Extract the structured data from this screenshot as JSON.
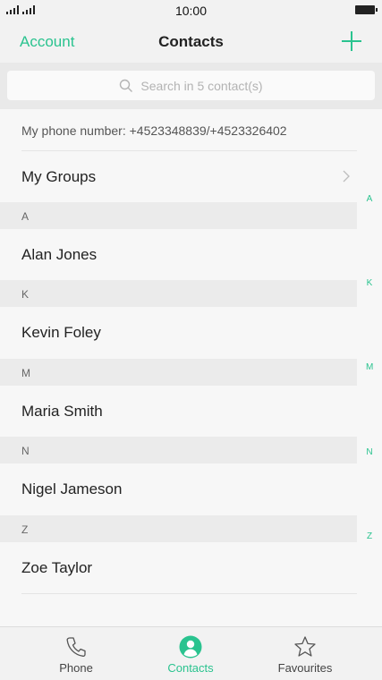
{
  "status_bar": {
    "time": "10:00"
  },
  "nav": {
    "account": "Account",
    "title": "Contacts"
  },
  "search": {
    "placeholder": "Search in 5 contact(s)"
  },
  "my_number": "My phone number: +4523348839/+4523326402",
  "groups_label": "My Groups",
  "sections": [
    {
      "letter": "A",
      "contact": "Alan Jones"
    },
    {
      "letter": "K",
      "contact": "Kevin Foley"
    },
    {
      "letter": "M",
      "contact": "Maria Smith"
    },
    {
      "letter": "N",
      "contact": "Nigel Jameson"
    },
    {
      "letter": "Z",
      "contact": "Zoe Taylor"
    }
  ],
  "index_letters": [
    "A",
    "K",
    "M",
    "N",
    "Z"
  ],
  "tabs": [
    {
      "label": "Phone",
      "icon": "phone-icon"
    },
    {
      "label": "Contacts",
      "icon": "person-icon",
      "active": true
    },
    {
      "label": "Favourites",
      "icon": "star-icon"
    }
  ],
  "colors": {
    "accent": "#2ac38f"
  }
}
